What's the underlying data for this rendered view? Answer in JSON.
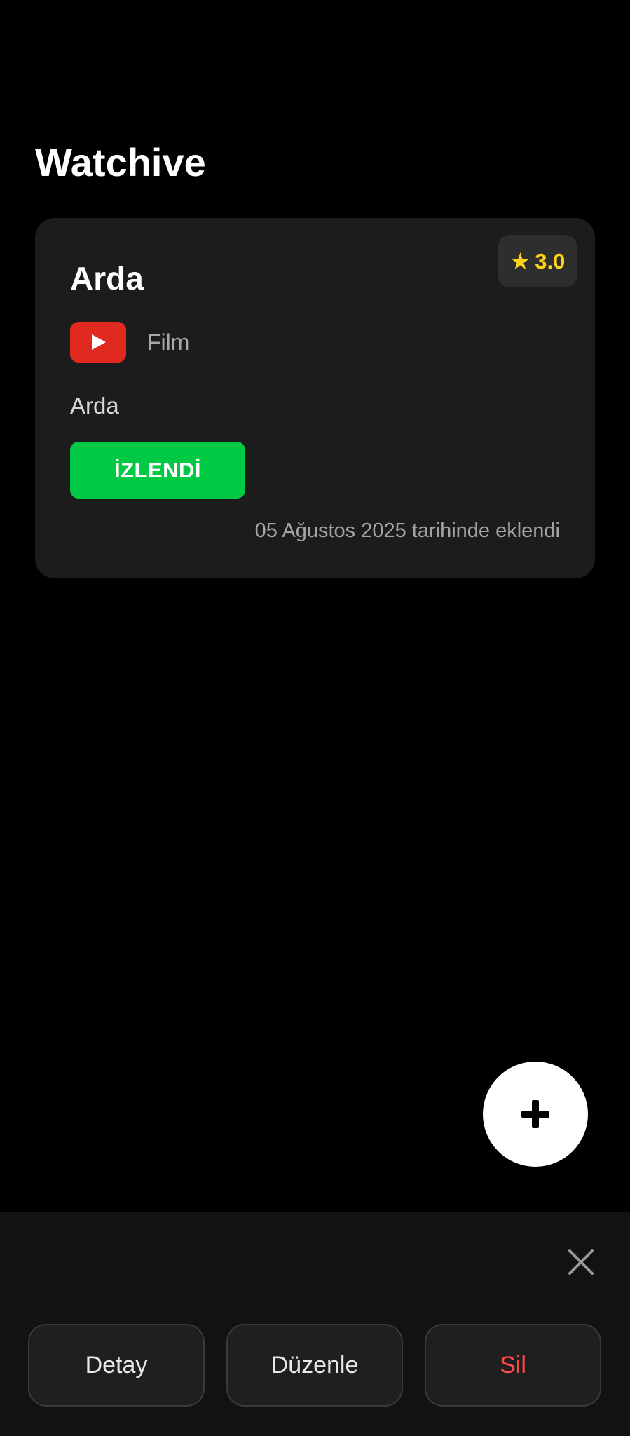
{
  "app": {
    "title": "Watchive"
  },
  "card": {
    "title": "Arda",
    "rating_star": "★",
    "rating": "3.0",
    "platform_icon": "youtube-icon",
    "category": "Film",
    "note": "Arda",
    "status_label": "İZLENDİ",
    "added_date": "05 Ağustos 2025 tarihinde eklendi"
  },
  "fab": {
    "icon": "plus-icon"
  },
  "bottom_sheet": {
    "close_icon": "close-icon",
    "actions": {
      "detail": "Detay",
      "edit": "Düzenle",
      "delete": "Sil"
    }
  },
  "colors": {
    "background": "#000000",
    "card": "#1c1c1c",
    "rating": "#ffd21a",
    "status_green": "#00c944",
    "youtube_red": "#e12a1f",
    "delete_red": "#ff4a4a"
  }
}
